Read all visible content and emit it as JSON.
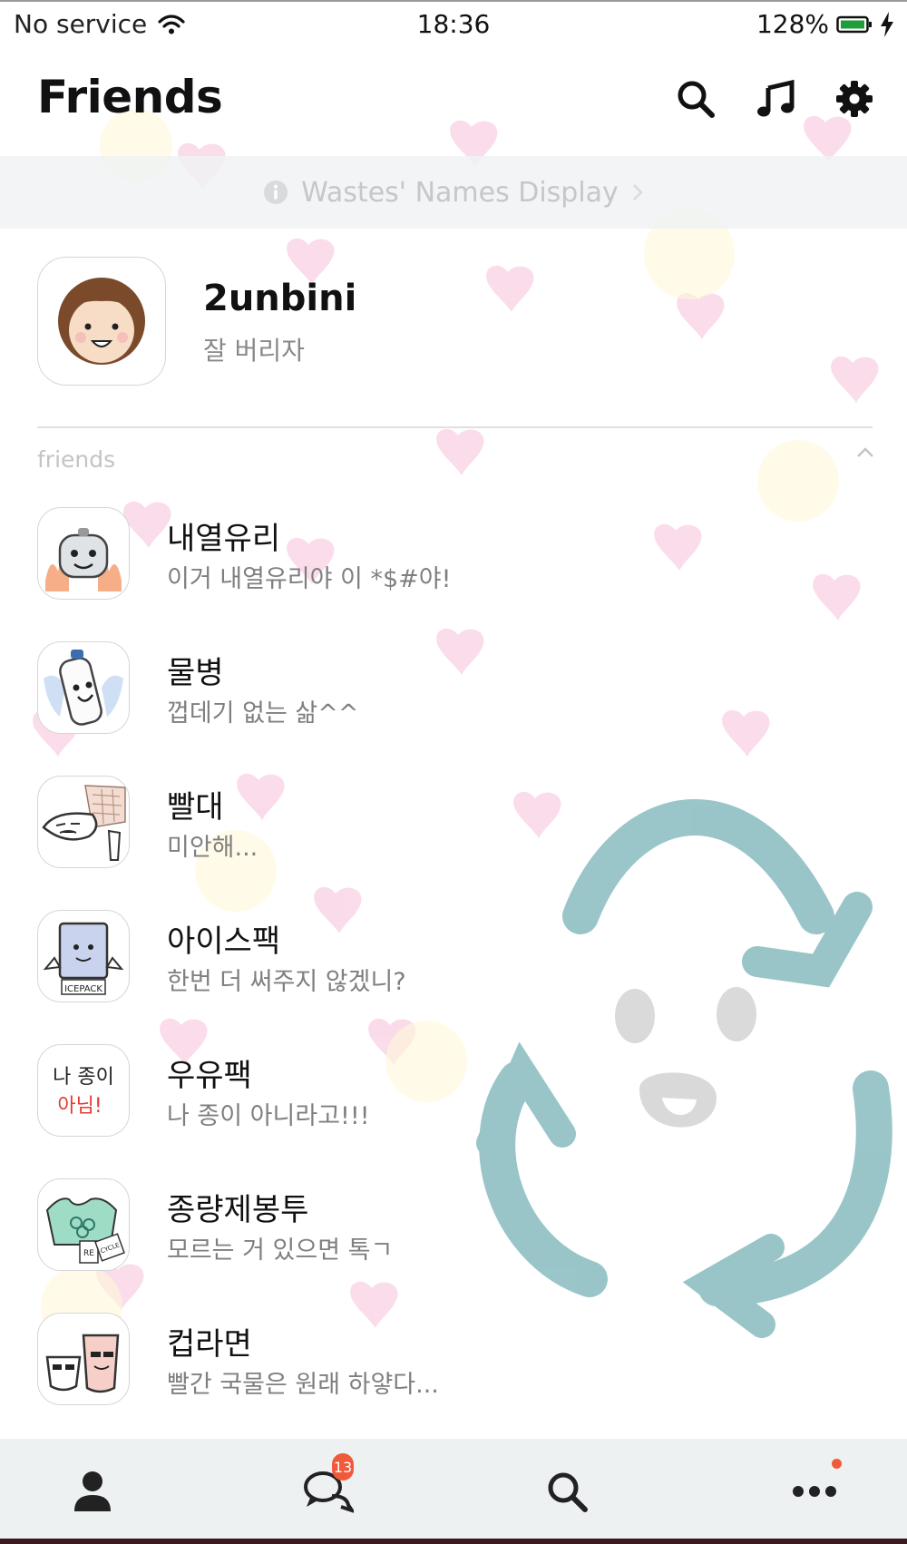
{
  "status_bar": {
    "carrier": "No service",
    "time": "18:36",
    "battery": "128%"
  },
  "header": {
    "title": "Friends",
    "icons": [
      "search-icon",
      "music-note-icon",
      "gear-icon"
    ]
  },
  "notice": {
    "icon": "info-icon",
    "text": "Wastes' Names Display"
  },
  "profile": {
    "name": "2unbini",
    "status": "잘 버리자"
  },
  "friends_section": {
    "label": "friends",
    "friends": [
      {
        "name": "내열유리",
        "message": "이거 내열유리야 이 *$#야!"
      },
      {
        "name": "물병",
        "message": "껍데기 없는 삶^^"
      },
      {
        "name": "빨대",
        "message": "미안해..."
      },
      {
        "name": "아이스팩",
        "message": "한번 더 써주지 않겠니?",
        "avatar_text": "ICEPACK"
      },
      {
        "name": "우유팩",
        "message": "나 종이 아니라고!!!",
        "avatar_text_1": "나 종이",
        "avatar_text_2": "아님!"
      },
      {
        "name": "종량제봉투",
        "message": "모르는 거 있으면 톡ㄱ",
        "avatar_text_1": "RE",
        "avatar_text_2": "CYCLE"
      },
      {
        "name": "컵라면",
        "message": "빨간 국물은 원래 하얗다..."
      }
    ]
  },
  "tab_bar": {
    "tabs": [
      "person-icon",
      "chat-icon",
      "search-icon",
      "more-icon"
    ],
    "chat_badge": "13"
  },
  "colors": {
    "badge": "#f05a3a",
    "tab_bar_bg": "#eef1f2",
    "recycle_teal": "#8fbfc3",
    "heart_pink": "#f6b9d6"
  }
}
